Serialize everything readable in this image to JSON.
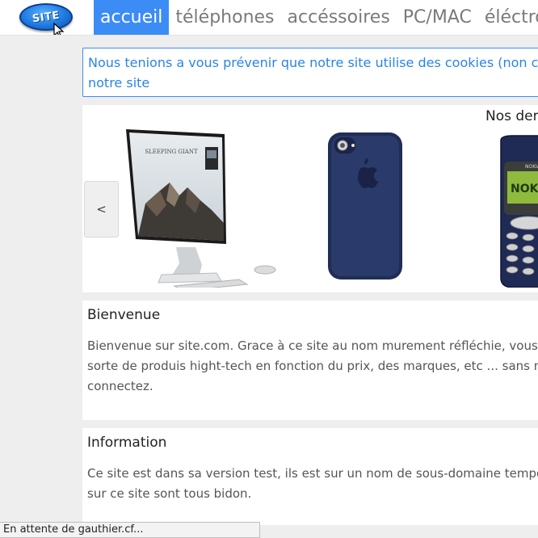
{
  "nav": {
    "logo_text": "SITE",
    "items": [
      {
        "label": "accueil",
        "active": true
      },
      {
        "label": "téléphones"
      },
      {
        "label": "accéssoires"
      },
      {
        "label": "PC/MAC"
      },
      {
        "label": "éléctrome"
      }
    ]
  },
  "cookie": {
    "line1": "Nous tenions a vous prévenir que notre site utilise des cookies (non ceu",
    "line2": "notre site"
  },
  "carousel": {
    "title": "Nos der",
    "prev_label": "<",
    "products": [
      {
        "icon": "all-in-one-pc-icon",
        "screen_text": "SLEEPING GIANT"
      },
      {
        "icon": "smartphone-case-icon"
      },
      {
        "icon": "nokia-phone-icon",
        "brand": "NOKIA"
      }
    ]
  },
  "welcome": {
    "title": "Bienvenue",
    "lines": [
      "Bienvenue sur site.com. Grace à ce site au nom murement réfléchie, vous",
      "sorte de produis hight-tech en fonction du prix, des marques, etc ... sans n",
      "connectez."
    ]
  },
  "info": {
    "title": "Information",
    "lines": [
      "Ce site est dans sa version test, ils est sur un nom de sous-domaine tempo",
      "sur ce site sont tous bidon."
    ]
  },
  "status": {
    "text": "En attente de gauthier.cf..."
  },
  "colors": {
    "accent": "#3b8cf5",
    "cookie_text": "#2a84e8",
    "background": "#eeeeee"
  }
}
